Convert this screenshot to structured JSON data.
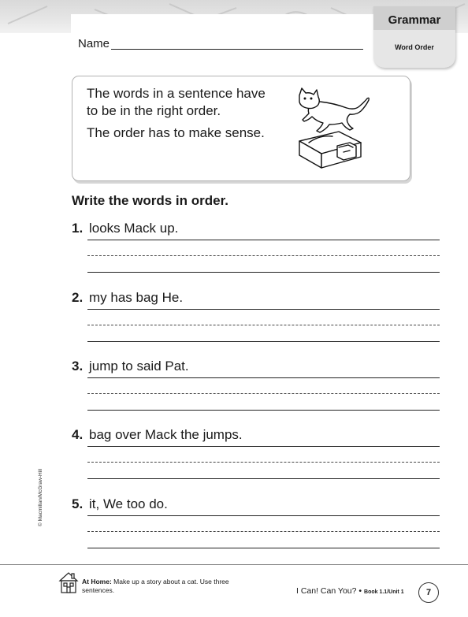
{
  "header": {
    "name_label": "Name",
    "tab_title": "Grammar",
    "tab_subtitle": "Word Order"
  },
  "rule_box": {
    "line1": "The words in a sentence have",
    "line2": "to be in the right order.",
    "line3": "The order has to make sense.",
    "illustration": "cat-jumping-over-bag-illustration"
  },
  "instructions": "Write the words in order.",
  "items": [
    {
      "number": "1.",
      "words": "looks Mack up."
    },
    {
      "number": "2.",
      "words": "my has bag He."
    },
    {
      "number": "3.",
      "words": "jump to said Pat."
    },
    {
      "number": "4.",
      "words": "bag over Mack the jumps."
    },
    {
      "number": "5.",
      "words": "it, We too do."
    }
  ],
  "side_credit": "© Macmillan/McGraw-Hill",
  "footer": {
    "at_home_label": "At Home:",
    "at_home_text": "Make up a story about a cat. Use three sentences.",
    "book_title": "I Can! Can You?",
    "bullet": "•",
    "book_ref": "Book 1.1/Unit 1",
    "page_number": "7"
  }
}
